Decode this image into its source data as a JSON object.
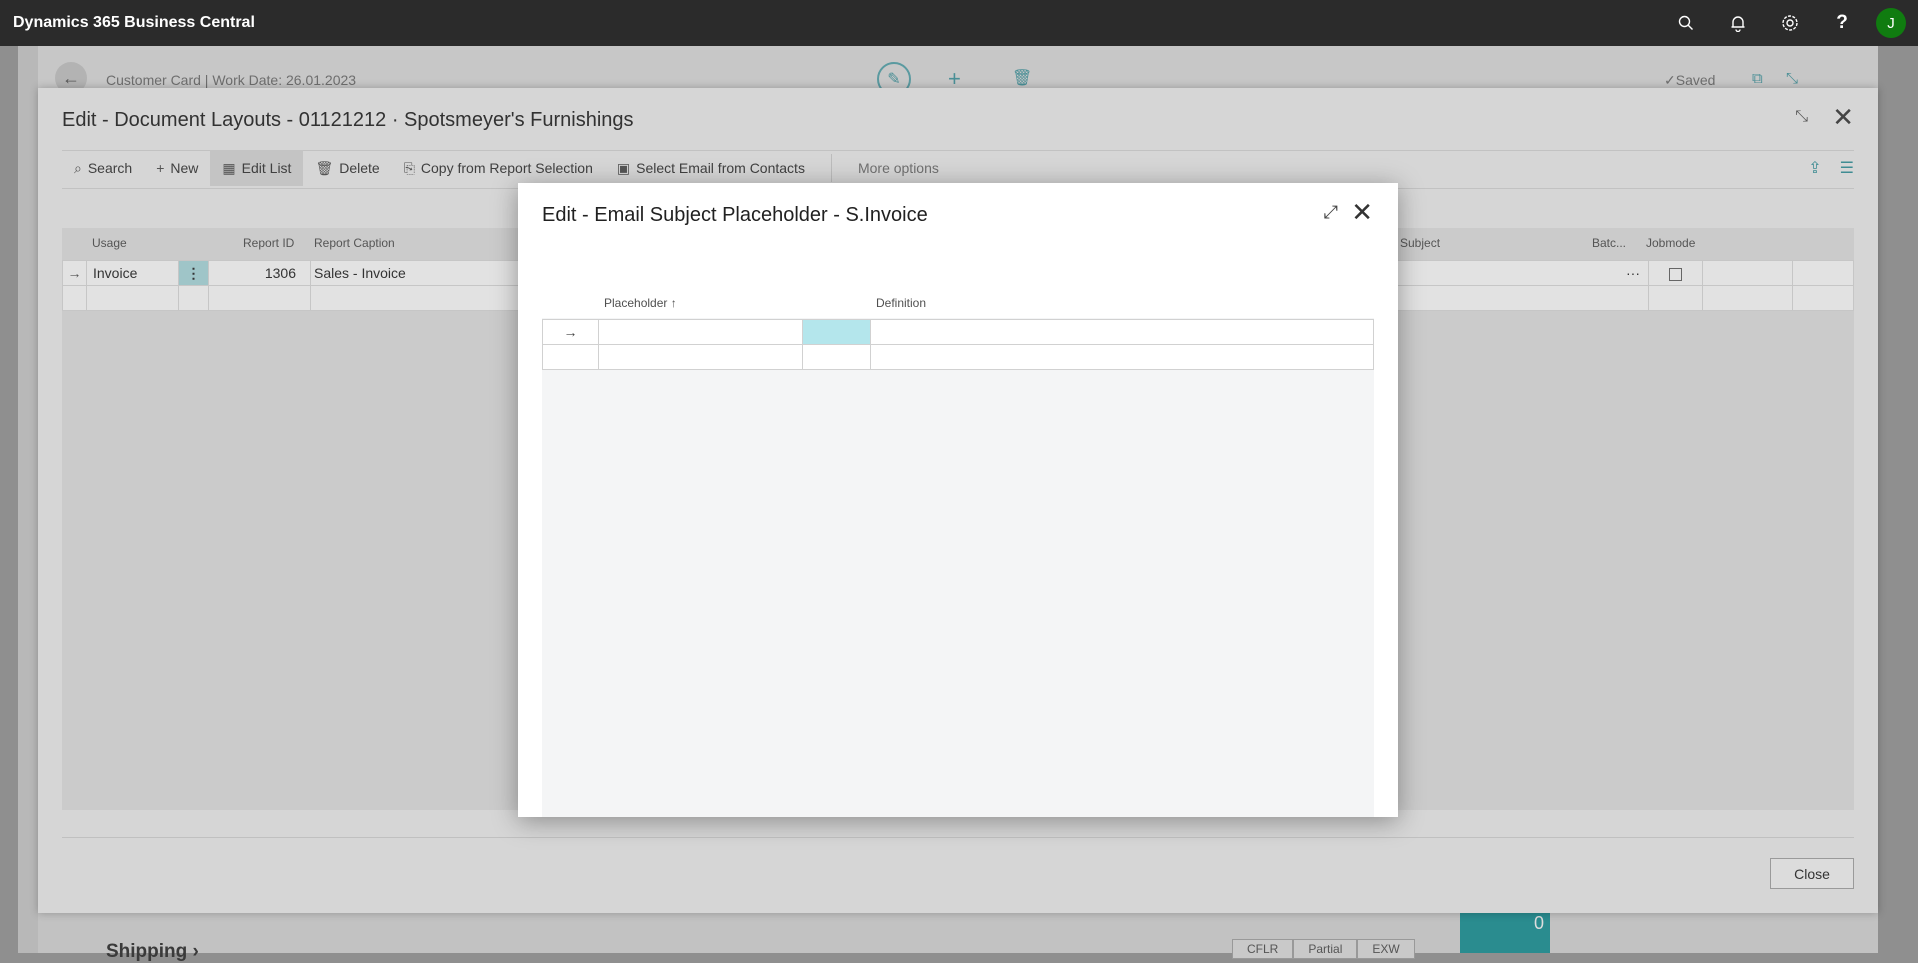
{
  "app": {
    "brand": "Dynamics 365 Business Central",
    "icons": [
      "search-icon",
      "bell-icon",
      "gear-icon",
      "help-icon"
    ],
    "avatar_initial": "J"
  },
  "customer_card": {
    "title": "Customer Card | Work Date: 26.01.2023",
    "saved_label": "✓Saved",
    "shipping_label": "Shipping ›",
    "tags": [
      "CFLR",
      "Partial",
      "EXW"
    ],
    "tile_value": "0"
  },
  "document_layouts": {
    "title": "Edit - Document Layouts - 01121212 · Spotsmeyer's Furnishings",
    "toolbar": {
      "search": "Search",
      "new": "New",
      "edit_list": "Edit List",
      "delete": "Delete",
      "copy": "Copy from Report Selection",
      "select_email": "Select Email from Contacts",
      "more": "More options"
    },
    "columns": {
      "usage": "Usage",
      "report_id": "Report ID",
      "report_caption": "Report Caption",
      "subject": "Subject",
      "batch": "Batc...",
      "jobmode": "Jobmode"
    },
    "rows": [
      {
        "usage": "Invoice",
        "report_id": "1306",
        "report_caption": "Sales - Invoice"
      }
    ],
    "close_button": "Close"
  },
  "modal": {
    "title": "Edit - Email Subject Placeholder - S.Invoice",
    "columns": {
      "placeholder": "Placeholder ↑",
      "definition": "Definition"
    }
  }
}
